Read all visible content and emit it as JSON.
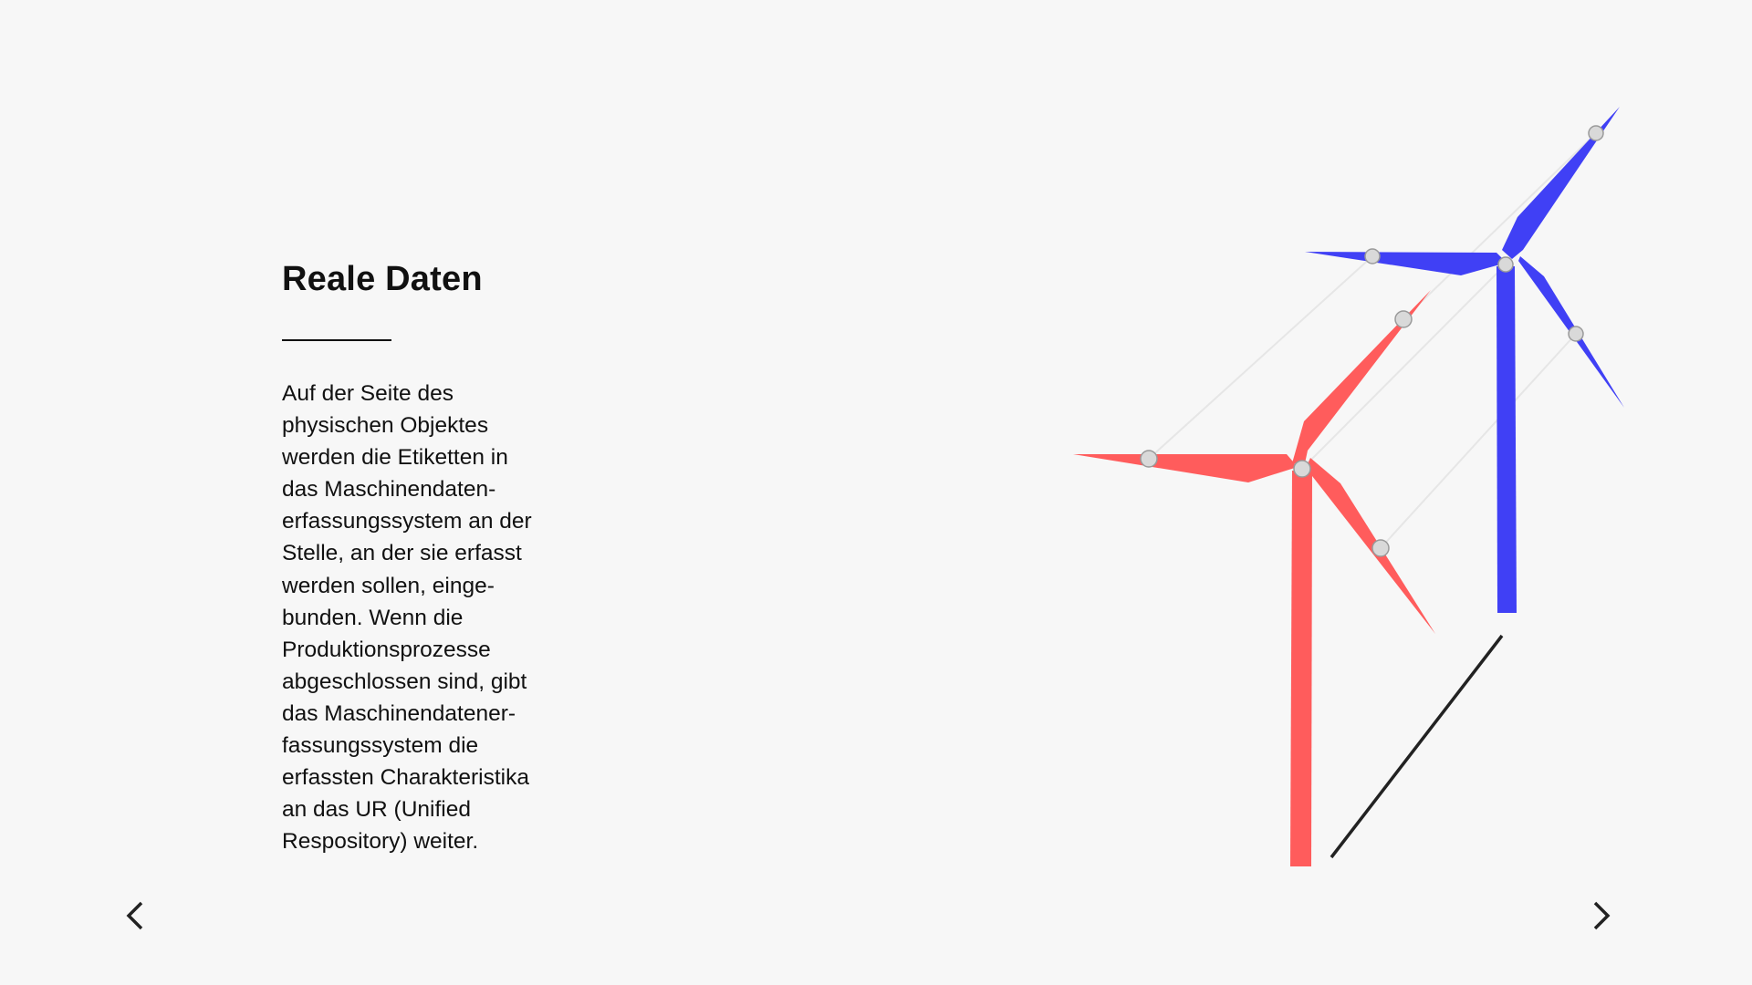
{
  "section": {
    "title": "Reale Daten",
    "body": "Auf der Seite des\nphysischen Objektes\nwerden die Etiketten in\ndas Maschinendaten-\nerfassungssystem an der\nStelle, an der sie erfasst\nwerden sollen, einge-\nbunden. Wenn die\nProduktionsprozesse\nabgeschlossen sind, gibt\ndas Maschinendatener-\nfassungssystem die\nerfassten Charakteristika\nan das UR (Unified\nRespository) weiter."
  },
  "navigation": {
    "prev_icon": "chevron-left-icon",
    "next_icon": "chevron-right-icon"
  },
  "illustration": {
    "subject": "wind-turbines",
    "colors": {
      "physical_turbine": "#ff5c5c",
      "digital_turbine": "#4040f5",
      "connector_lines": "#e6e6e6",
      "marker_fill": "#d9d9d9",
      "marker_stroke": "#9a9a9a",
      "ground_line": "#222222"
    }
  }
}
